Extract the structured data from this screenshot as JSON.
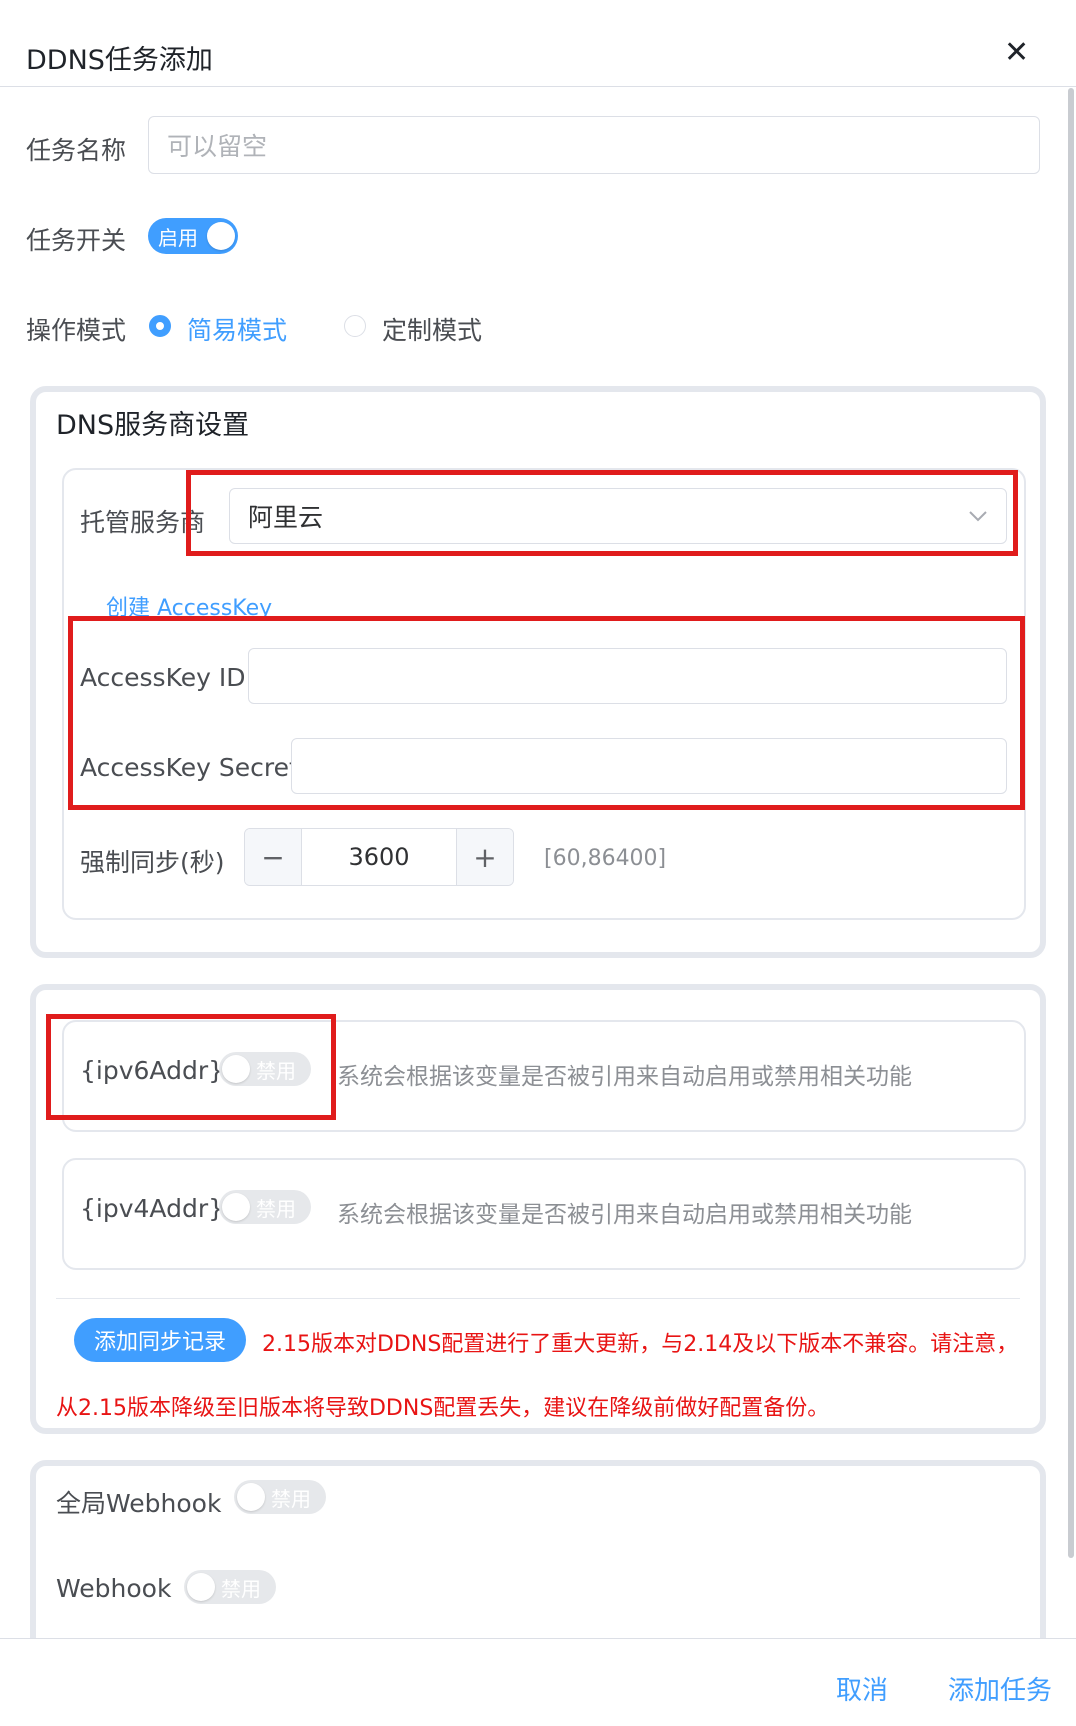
{
  "dialog": {
    "title": "DDNS任务添加",
    "close_glyph": "✕"
  },
  "form": {
    "task_name": {
      "label": "任务名称",
      "placeholder": "可以留空",
      "value": ""
    },
    "task_switch": {
      "label": "任务开关",
      "state_label": "启用",
      "enabled": true
    },
    "mode": {
      "label": "操作模式",
      "options": [
        "简易模式",
        "定制模式"
      ],
      "selected": "简易模式"
    }
  },
  "dns_panel": {
    "title": "DNS服务商设置",
    "provider": {
      "label": "托管服务商",
      "value": "阿里云"
    },
    "create_key_link": "创建 AccessKey",
    "access_key_id": {
      "label": "AccessKey ID",
      "value": ""
    },
    "access_key_secret": {
      "label": "AccessKey Secret",
      "value": ""
    },
    "force_sync": {
      "label": "强制同步(秒)",
      "value": "3600",
      "minus": "−",
      "plus": "+",
      "range": "[60,86400]"
    }
  },
  "records_panel": {
    "ipv6": {
      "var": "{ipv6Addr}",
      "state_label": "禁用",
      "enabled": false,
      "hint": "系统会根据该变量是否被引用来自动启用或禁用相关功能"
    },
    "ipv4": {
      "var": "{ipv4Addr}",
      "state_label": "禁用",
      "enabled": false,
      "hint": "系统会根据该变量是否被引用来自动启用或禁用相关功能"
    },
    "add_record_button": "添加同步记录",
    "warning_line1": "2.15版本对DDNS配置进行了重大更新，与2.14及以下版本不兼容。请注意，",
    "warning_line2": "从2.15版本降级至旧版本将导致DDNS配置丢失，建议在降级前做好配置备份。"
  },
  "webhook_panel": {
    "global_webhook": {
      "label": "全局Webhook",
      "state_label": "禁用",
      "enabled": false
    },
    "webhook": {
      "label": "Webhook",
      "state_label": "禁用",
      "enabled": false
    }
  },
  "footer": {
    "cancel": "取消",
    "submit": "添加任务"
  },
  "colors": {
    "accent": "#409eff",
    "annotation_red": "#e01c1c",
    "warning_text": "#e81414"
  }
}
